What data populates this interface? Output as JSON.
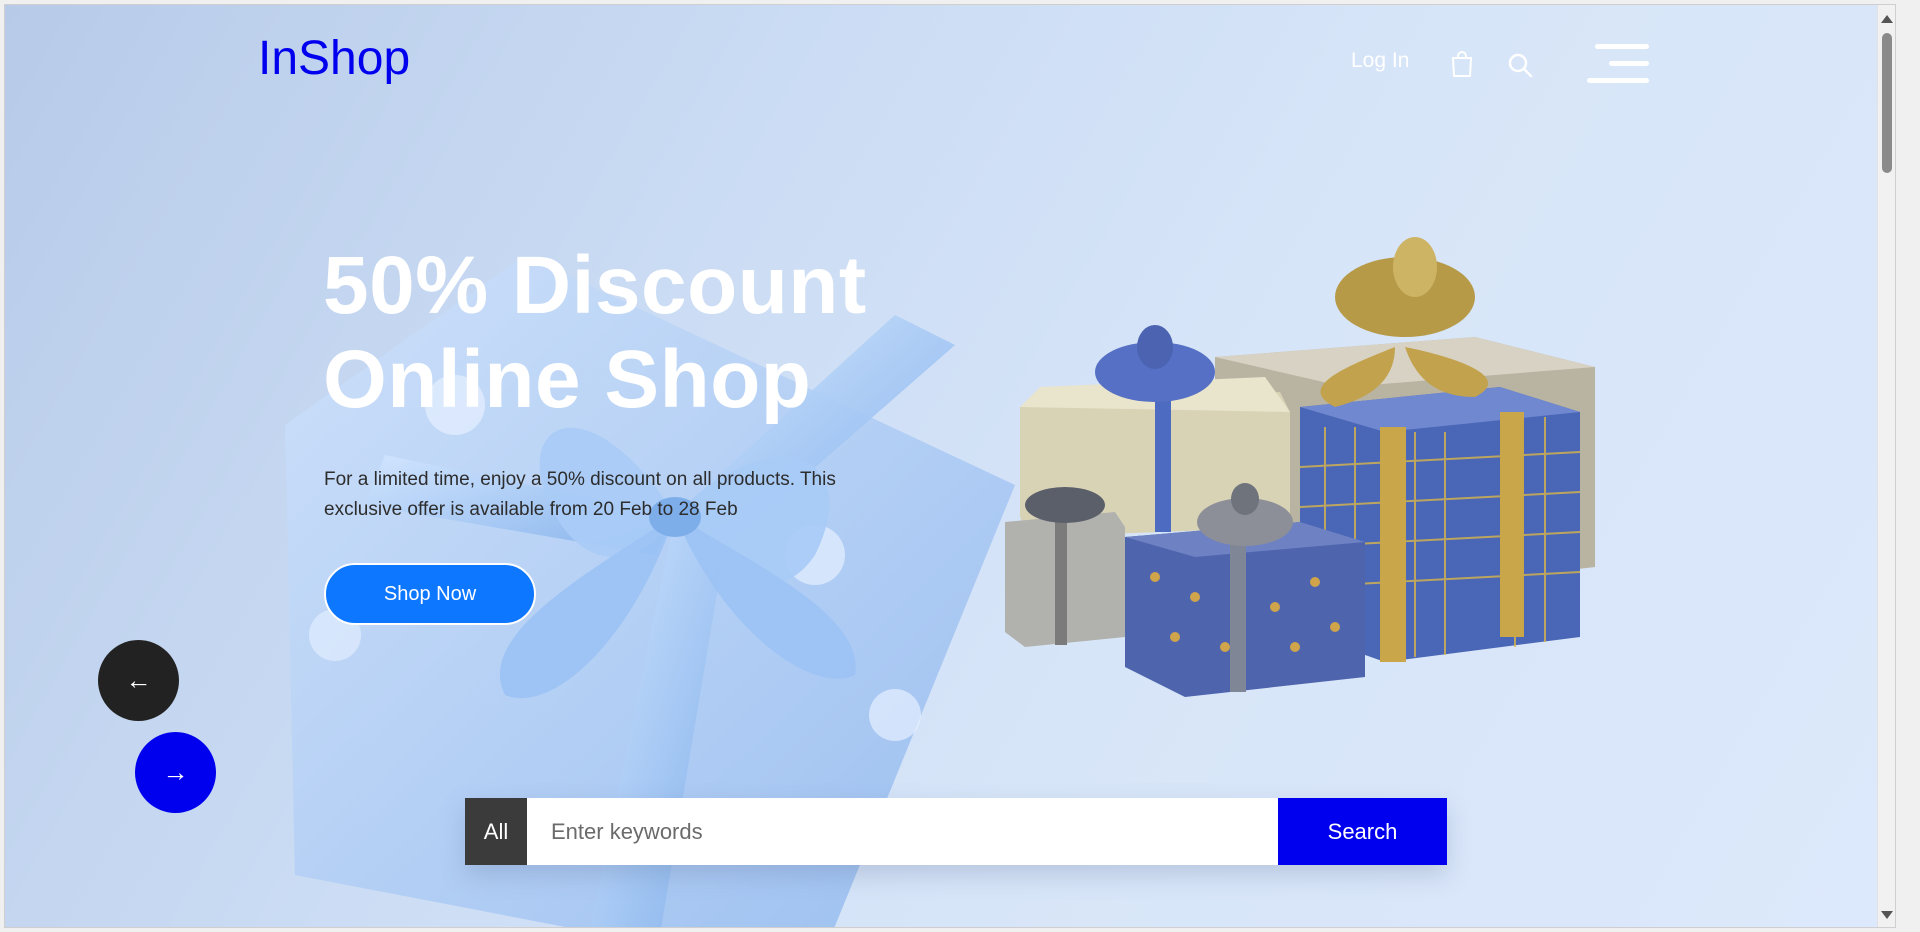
{
  "header": {
    "logo": "InShop",
    "login_label": "Log In",
    "icons": [
      "shopping-bag-icon",
      "search-icon",
      "menu-icon"
    ]
  },
  "hero": {
    "headline_line1": "50% Discount",
    "headline_line2": "Online Shop",
    "description": "For a limited time, enjoy a 50% discount on all products. This exclusive offer is available from 20 Feb to 28 Feb",
    "cta_label": "Shop Now"
  },
  "carousel": {
    "prev_label": "←",
    "next_label": "→"
  },
  "search": {
    "category_label": "All",
    "placeholder": "Enter keywords",
    "value": "",
    "button_label": "Search"
  },
  "colors": {
    "brand": "#0000ee",
    "cta": "#0d77ff",
    "dark_button": "#222222"
  }
}
